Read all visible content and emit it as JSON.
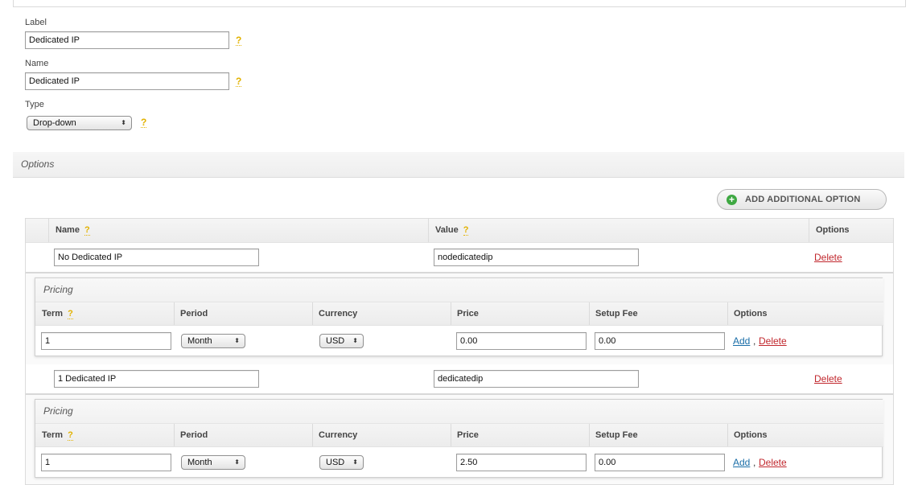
{
  "form": {
    "label_title": "Label",
    "label_value": "Dedicated IP",
    "name_title": "Name",
    "name_value": "Dedicated IP",
    "type_title": "Type",
    "type_value": "Drop-down",
    "help_glyph": "?"
  },
  "options_section": {
    "title": "Options",
    "add_button_label": "ADD ADDITIONAL OPTION",
    "columns": {
      "name": "Name",
      "value": "Value",
      "options": "Options"
    },
    "rows": [
      {
        "name": "No Dedicated IP",
        "value": "nodedicatedip",
        "delete_label": "Delete",
        "pricing": {
          "title": "Pricing",
          "columns": {
            "term": "Term",
            "period": "Period",
            "currency": "Currency",
            "price": "Price",
            "setup_fee": "Setup Fee",
            "options": "Options"
          },
          "term": "1",
          "period": "Month",
          "currency": "USD",
          "price": "0.00",
          "setup_fee": "0.00",
          "add_label": "Add",
          "delete_label": "Delete"
        }
      },
      {
        "name": "1 Dedicated IP",
        "value": "dedicatedip",
        "delete_label": "Delete",
        "pricing": {
          "title": "Pricing",
          "columns": {
            "term": "Term",
            "period": "Period",
            "currency": "Currency",
            "price": "Price",
            "setup_fee": "Setup Fee",
            "options": "Options"
          },
          "term": "1",
          "period": "Month",
          "currency": "USD",
          "price": "2.50",
          "setup_fee": "0.00",
          "add_label": "Add",
          "delete_label": "Delete"
        }
      }
    ]
  },
  "icons": {
    "help": "question-mark-icon",
    "add": "plus-circle-icon",
    "select_arrow": "up-down-arrows-icon"
  },
  "colors": {
    "help": "#e2b200",
    "add_green": "#3ea842",
    "delete_red": "#c1272d",
    "link_blue": "#1a6ea8"
  }
}
